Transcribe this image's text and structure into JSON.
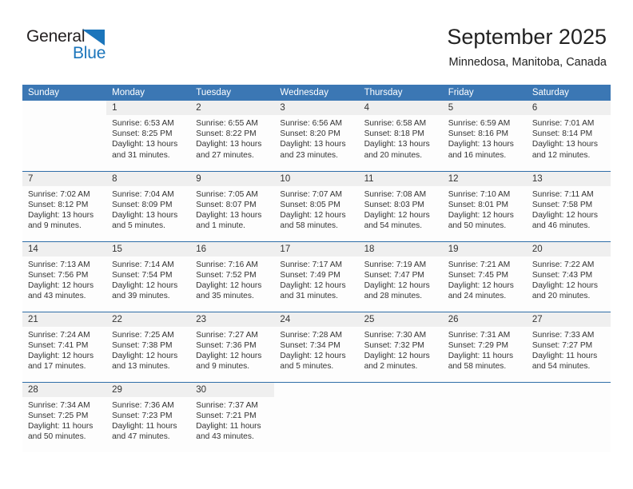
{
  "logo": {
    "word_one": "General",
    "word_two": "Blue",
    "triangle": "blue-triangle-icon",
    "brand_color": "#1b75bb"
  },
  "header": {
    "title": "September 2025",
    "subtitle": "Minnedosa, Manitoba, Canada",
    "accent_color": "#3b77b4"
  },
  "calendar": {
    "weekday_headers": [
      "Sunday",
      "Monday",
      "Tuesday",
      "Wednesday",
      "Thursday",
      "Friday",
      "Saturday"
    ],
    "weeks": [
      [
        {
          "day": "",
          "sunrise": "",
          "sunset": "",
          "daylight_line1": "",
          "daylight_line2": ""
        },
        {
          "day": "1",
          "sunrise": "Sunrise: 6:53 AM",
          "sunset": "Sunset: 8:25 PM",
          "daylight_line1": "Daylight: 13 hours",
          "daylight_line2": "and 31 minutes."
        },
        {
          "day": "2",
          "sunrise": "Sunrise: 6:55 AM",
          "sunset": "Sunset: 8:22 PM",
          "daylight_line1": "Daylight: 13 hours",
          "daylight_line2": "and 27 minutes."
        },
        {
          "day": "3",
          "sunrise": "Sunrise: 6:56 AM",
          "sunset": "Sunset: 8:20 PM",
          "daylight_line1": "Daylight: 13 hours",
          "daylight_line2": "and 23 minutes."
        },
        {
          "day": "4",
          "sunrise": "Sunrise: 6:58 AM",
          "sunset": "Sunset: 8:18 PM",
          "daylight_line1": "Daylight: 13 hours",
          "daylight_line2": "and 20 minutes."
        },
        {
          "day": "5",
          "sunrise": "Sunrise: 6:59 AM",
          "sunset": "Sunset: 8:16 PM",
          "daylight_line1": "Daylight: 13 hours",
          "daylight_line2": "and 16 minutes."
        },
        {
          "day": "6",
          "sunrise": "Sunrise: 7:01 AM",
          "sunset": "Sunset: 8:14 PM",
          "daylight_line1": "Daylight: 13 hours",
          "daylight_line2": "and 12 minutes."
        }
      ],
      [
        {
          "day": "7",
          "sunrise": "Sunrise: 7:02 AM",
          "sunset": "Sunset: 8:12 PM",
          "daylight_line1": "Daylight: 13 hours",
          "daylight_line2": "and 9 minutes."
        },
        {
          "day": "8",
          "sunrise": "Sunrise: 7:04 AM",
          "sunset": "Sunset: 8:09 PM",
          "daylight_line1": "Daylight: 13 hours",
          "daylight_line2": "and 5 minutes."
        },
        {
          "day": "9",
          "sunrise": "Sunrise: 7:05 AM",
          "sunset": "Sunset: 8:07 PM",
          "daylight_line1": "Daylight: 13 hours",
          "daylight_line2": "and 1 minute."
        },
        {
          "day": "10",
          "sunrise": "Sunrise: 7:07 AM",
          "sunset": "Sunset: 8:05 PM",
          "daylight_line1": "Daylight: 12 hours",
          "daylight_line2": "and 58 minutes."
        },
        {
          "day": "11",
          "sunrise": "Sunrise: 7:08 AM",
          "sunset": "Sunset: 8:03 PM",
          "daylight_line1": "Daylight: 12 hours",
          "daylight_line2": "and 54 minutes."
        },
        {
          "day": "12",
          "sunrise": "Sunrise: 7:10 AM",
          "sunset": "Sunset: 8:01 PM",
          "daylight_line1": "Daylight: 12 hours",
          "daylight_line2": "and 50 minutes."
        },
        {
          "day": "13",
          "sunrise": "Sunrise: 7:11 AM",
          "sunset": "Sunset: 7:58 PM",
          "daylight_line1": "Daylight: 12 hours",
          "daylight_line2": "and 46 minutes."
        }
      ],
      [
        {
          "day": "14",
          "sunrise": "Sunrise: 7:13 AM",
          "sunset": "Sunset: 7:56 PM",
          "daylight_line1": "Daylight: 12 hours",
          "daylight_line2": "and 43 minutes."
        },
        {
          "day": "15",
          "sunrise": "Sunrise: 7:14 AM",
          "sunset": "Sunset: 7:54 PM",
          "daylight_line1": "Daylight: 12 hours",
          "daylight_line2": "and 39 minutes."
        },
        {
          "day": "16",
          "sunrise": "Sunrise: 7:16 AM",
          "sunset": "Sunset: 7:52 PM",
          "daylight_line1": "Daylight: 12 hours",
          "daylight_line2": "and 35 minutes."
        },
        {
          "day": "17",
          "sunrise": "Sunrise: 7:17 AM",
          "sunset": "Sunset: 7:49 PM",
          "daylight_line1": "Daylight: 12 hours",
          "daylight_line2": "and 31 minutes."
        },
        {
          "day": "18",
          "sunrise": "Sunrise: 7:19 AM",
          "sunset": "Sunset: 7:47 PM",
          "daylight_line1": "Daylight: 12 hours",
          "daylight_line2": "and 28 minutes."
        },
        {
          "day": "19",
          "sunrise": "Sunrise: 7:21 AM",
          "sunset": "Sunset: 7:45 PM",
          "daylight_line1": "Daylight: 12 hours",
          "daylight_line2": "and 24 minutes."
        },
        {
          "day": "20",
          "sunrise": "Sunrise: 7:22 AM",
          "sunset": "Sunset: 7:43 PM",
          "daylight_line1": "Daylight: 12 hours",
          "daylight_line2": "and 20 minutes."
        }
      ],
      [
        {
          "day": "21",
          "sunrise": "Sunrise: 7:24 AM",
          "sunset": "Sunset: 7:41 PM",
          "daylight_line1": "Daylight: 12 hours",
          "daylight_line2": "and 17 minutes."
        },
        {
          "day": "22",
          "sunrise": "Sunrise: 7:25 AM",
          "sunset": "Sunset: 7:38 PM",
          "daylight_line1": "Daylight: 12 hours",
          "daylight_line2": "and 13 minutes."
        },
        {
          "day": "23",
          "sunrise": "Sunrise: 7:27 AM",
          "sunset": "Sunset: 7:36 PM",
          "daylight_line1": "Daylight: 12 hours",
          "daylight_line2": "and 9 minutes."
        },
        {
          "day": "24",
          "sunrise": "Sunrise: 7:28 AM",
          "sunset": "Sunset: 7:34 PM",
          "daylight_line1": "Daylight: 12 hours",
          "daylight_line2": "and 5 minutes."
        },
        {
          "day": "25",
          "sunrise": "Sunrise: 7:30 AM",
          "sunset": "Sunset: 7:32 PM",
          "daylight_line1": "Daylight: 12 hours",
          "daylight_line2": "and 2 minutes."
        },
        {
          "day": "26",
          "sunrise": "Sunrise: 7:31 AM",
          "sunset": "Sunset: 7:29 PM",
          "daylight_line1": "Daylight: 11 hours",
          "daylight_line2": "and 58 minutes."
        },
        {
          "day": "27",
          "sunrise": "Sunrise: 7:33 AM",
          "sunset": "Sunset: 7:27 PM",
          "daylight_line1": "Daylight: 11 hours",
          "daylight_line2": "and 54 minutes."
        }
      ],
      [
        {
          "day": "28",
          "sunrise": "Sunrise: 7:34 AM",
          "sunset": "Sunset: 7:25 PM",
          "daylight_line1": "Daylight: 11 hours",
          "daylight_line2": "and 50 minutes."
        },
        {
          "day": "29",
          "sunrise": "Sunrise: 7:36 AM",
          "sunset": "Sunset: 7:23 PM",
          "daylight_line1": "Daylight: 11 hours",
          "daylight_line2": "and 47 minutes."
        },
        {
          "day": "30",
          "sunrise": "Sunrise: 7:37 AM",
          "sunset": "Sunset: 7:21 PM",
          "daylight_line1": "Daylight: 11 hours",
          "daylight_line2": "and 43 minutes."
        },
        {
          "day": "",
          "sunrise": "",
          "sunset": "",
          "daylight_line1": "",
          "daylight_line2": ""
        },
        {
          "day": "",
          "sunrise": "",
          "sunset": "",
          "daylight_line1": "",
          "daylight_line2": ""
        },
        {
          "day": "",
          "sunrise": "",
          "sunset": "",
          "daylight_line1": "",
          "daylight_line2": ""
        },
        {
          "day": "",
          "sunrise": "",
          "sunset": "",
          "daylight_line1": "",
          "daylight_line2": ""
        }
      ]
    ]
  }
}
